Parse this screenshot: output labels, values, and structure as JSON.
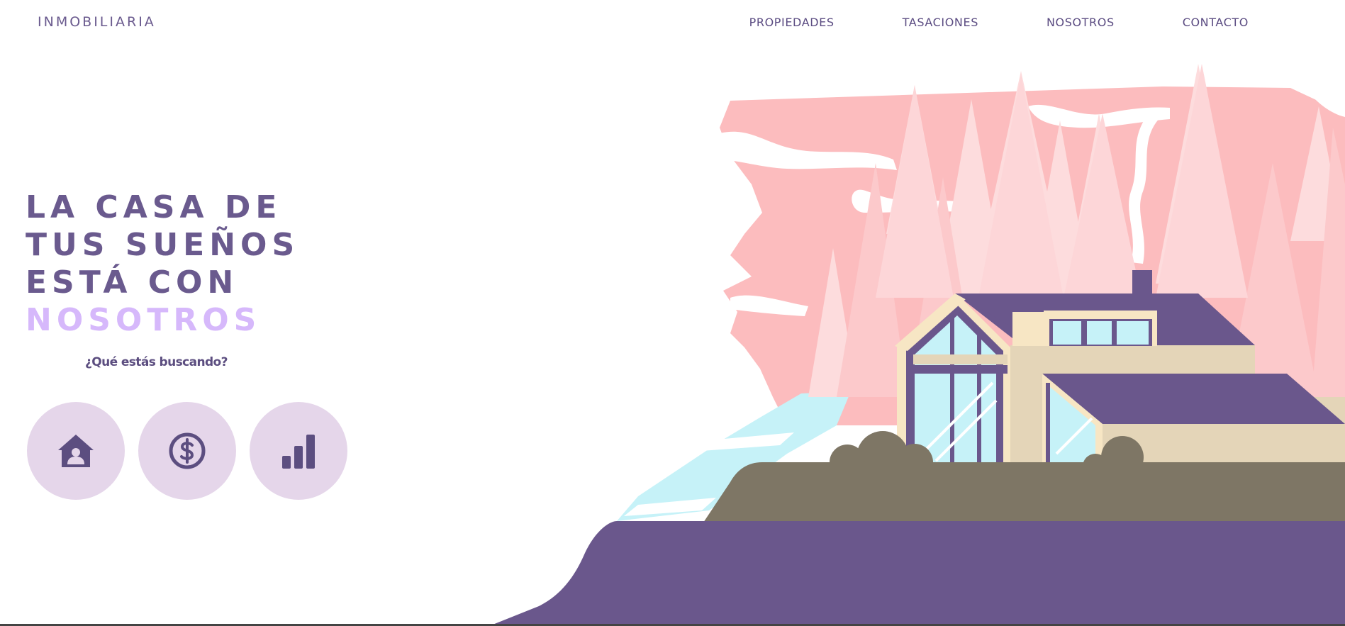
{
  "header": {
    "brand": "INMOBILIARIA",
    "nav": [
      {
        "label": "PROPIEDADES"
      },
      {
        "label": "TASACIONES"
      },
      {
        "label": "NOSOTROS"
      },
      {
        "label": "CONTACTO"
      }
    ]
  },
  "hero": {
    "headline": {
      "line1": "LA CASA DE",
      "line2": "TUS SUEÑOS",
      "line3": "ESTÁ CON",
      "highlight": "NOSOTROS"
    },
    "question": "¿Qué estás buscando?",
    "options": [
      {
        "icon": "house-icon"
      },
      {
        "icon": "dollar-icon"
      },
      {
        "icon": "bar-chart-icon"
      }
    ]
  },
  "colors": {
    "primary": "#6a5a8e",
    "accent": "#d6b8fb",
    "circle_bg": "#e5d6ea",
    "sky_pink": "#fcbcbe",
    "tree_light": "#fddcdd",
    "glass": "#c6f2f8",
    "ground_olive": "#7e7665",
    "ground_purple": "#6a578c",
    "wall_cream": "#e4d5b8"
  }
}
